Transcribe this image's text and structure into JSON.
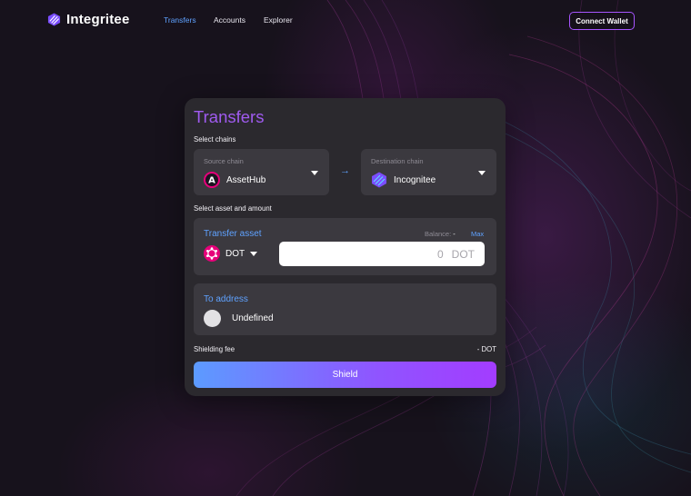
{
  "brand": {
    "name": "Integritee",
    "icon": "integritee-logo-icon"
  },
  "nav": {
    "links": [
      {
        "label": "Transfers",
        "active": true
      },
      {
        "label": "Accounts",
        "active": false
      },
      {
        "label": "Explorer",
        "active": false
      }
    ],
    "connect_label": "Connect Wallet"
  },
  "form": {
    "title": "Transfers",
    "select_chains_label": "Select chains",
    "source": {
      "caption": "Source chain",
      "name": "AssetHub",
      "icon": "assethub-icon"
    },
    "destination": {
      "caption": "Destination chain",
      "name": "Incognitee",
      "icon": "incognitee-icon"
    },
    "arrow_icon": "arrow-right-icon",
    "select_asset_label": "Select asset and amount",
    "asset": {
      "caption": "Transfer asset",
      "balance_label": "Balance:",
      "balance_value": "-",
      "max_label": "Max",
      "symbol": "DOT",
      "icon": "polkadot-icon",
      "amount_placeholder": "0",
      "amount_unit": "DOT"
    },
    "to": {
      "caption": "To address",
      "value": "Undefined"
    },
    "fee_label": "Shielding fee",
    "fee_value": "- DOT",
    "submit_label": "Shield"
  },
  "colors": {
    "accent_blue": "#5fa2ff",
    "accent_purple": "#a755ff",
    "card_bg": "#2b292e"
  }
}
